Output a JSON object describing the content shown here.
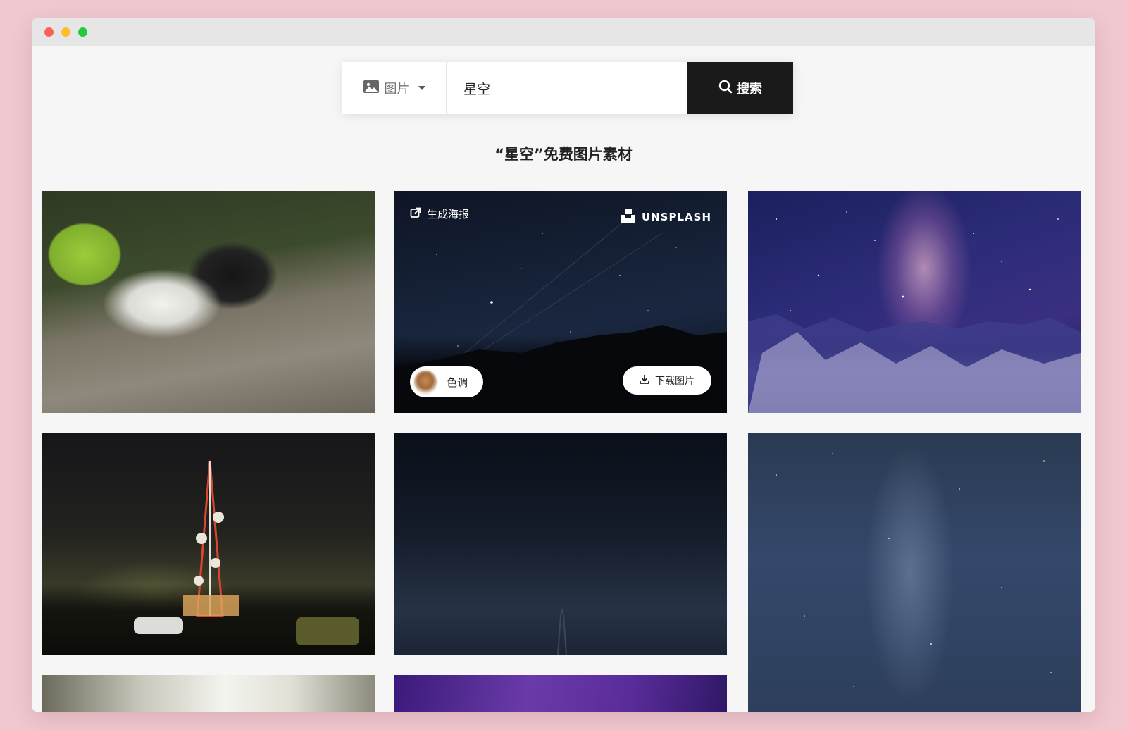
{
  "search": {
    "type_label": "图片",
    "query": "星空",
    "button_label": "搜索"
  },
  "results": {
    "title": "“星空”免费图片素材"
  },
  "hover_card": {
    "poster_label": "生成海报",
    "source_label": "UNSPLASH",
    "color_label": "色调",
    "download_label": "下载图片"
  },
  "icons": {
    "type_icon": "image-icon",
    "type_caret": "caret-down-icon",
    "search_icon": "search-icon",
    "poster_icon": "external-link-icon",
    "source_icon": "unsplash-logo-icon",
    "download_icon": "download-icon"
  },
  "colors": {
    "page_background": "#f0c8d0",
    "window_background": "#f6f6f6",
    "search_button": "#1a1a1a"
  }
}
